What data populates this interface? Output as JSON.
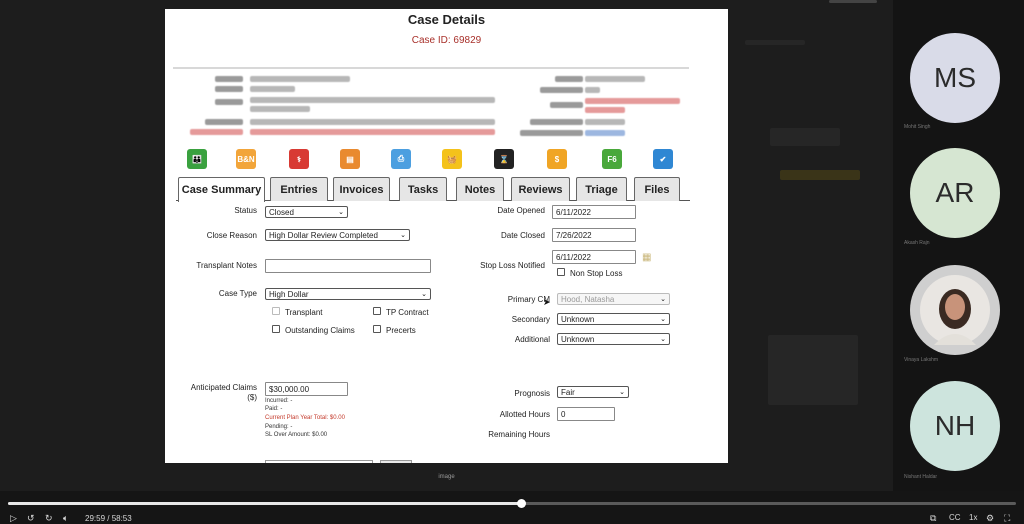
{
  "case_details": {
    "title": "Case Details",
    "case_id": "Case ID: 69829"
  },
  "tabs": [
    {
      "label": "Case Summary"
    },
    {
      "label": "Entries"
    },
    {
      "label": "Invoices"
    },
    {
      "label": "Tasks"
    },
    {
      "label": "Notes"
    },
    {
      "label": "Reviews"
    },
    {
      "label": "Triage"
    },
    {
      "label": "Files"
    }
  ],
  "toolbar_icons": [
    {
      "name": "family-icon",
      "glyph": "👪",
      "color": "#3aa13f"
    },
    {
      "name": "bln-icon",
      "glyph": "B&N",
      "color": "#f2a53a"
    },
    {
      "name": "caduceus-icon",
      "glyph": "⚕",
      "color": "#d83a33"
    },
    {
      "name": "document-icon",
      "glyph": "▤",
      "color": "#e98a2f"
    },
    {
      "name": "print-icon",
      "glyph": "⎙",
      "color": "#4c9fe0"
    },
    {
      "name": "basket-icon",
      "glyph": "🧺",
      "color": "#f4c21b"
    },
    {
      "name": "hourglass-icon",
      "glyph": "⌛",
      "color": "#222222"
    },
    {
      "name": "dollar-icon",
      "glyph": "$",
      "color": "#f0a525"
    },
    {
      "name": "f6-icon",
      "glyph": "F6",
      "color": "#49a83b"
    },
    {
      "name": "checklist-icon",
      "glyph": "✔",
      "color": "#2f87d3"
    }
  ],
  "form": {
    "status_label": "Status",
    "status_value": "Closed",
    "close_reason_label": "Close Reason",
    "close_reason_value": "High Dollar Review Completed",
    "transplant_notes_label": "Transplant Notes",
    "transplant_notes_value": "",
    "case_type_label": "Case Type",
    "case_type_value": "High Dollar",
    "transplant_label": "Transplant",
    "tp_contract_label": "TP Contract",
    "outstanding_claims_label": "Outstanding Claims",
    "precerts_label": "Precerts",
    "date_opened_label": "Date Opened",
    "date_opened_value": "6/11/2022",
    "date_closed_label": "Date Closed",
    "date_closed_value": "7/26/2022",
    "stop_loss_label": "Stop Loss Notified",
    "stop_loss_value": "6/11/2022",
    "non_stop_loss_label": "Non Stop Loss",
    "primary_cm_label": "Primary CM",
    "primary_cm_value": "Hood, Natasha",
    "secondary_label": "Secondary",
    "secondary_value": "Unknown",
    "additional_label": "Additional",
    "additional_value": "Unknown",
    "anticipated_claims_label_1": "Anticipated Claims",
    "anticipated_claims_label_2": "($)",
    "anticipated_claims_value": "$30,000.00",
    "incurred": "Incurred: -",
    "paid": "Paid: -",
    "current_plan_year": "Current Plan Year Total: $0.00",
    "pending": "Pending: -",
    "sl_over": "SL Over Amount: $0.00",
    "prognosis_label": "Prognosis",
    "prognosis_value": "Fair",
    "allotted_hours_label": "Allotted Hours",
    "allotted_hours_value": "0",
    "remaining_hours_label": "Remaining Hours"
  },
  "screen_caption": "image",
  "participants": [
    {
      "initials": "MS",
      "bg": "#d9dbe8",
      "name": "Mohit Singh"
    },
    {
      "initials": "AR",
      "bg": "#d6e6d2",
      "name": "Akash Rajn"
    },
    {
      "initials": "",
      "bg": "#cfcfcf",
      "name": "Vinaya Lakshm"
    },
    {
      "initials": "NH",
      "bg": "#cde4dd",
      "name": "Nishant Haldar"
    }
  ],
  "player": {
    "time": "29:59 / 58:53",
    "progress_fraction": 0.509,
    "speed": "1x"
  }
}
